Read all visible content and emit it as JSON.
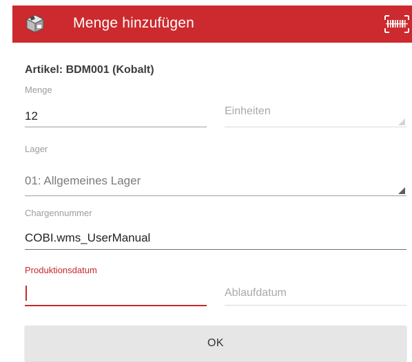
{
  "app_bar": {
    "title": "Menge hinzufügen",
    "background": "#cc2a2e",
    "left_icon": "box-app-icon",
    "right_icon": "barcode-scan-icon"
  },
  "form": {
    "article": "Artikel: BDM001 (Kobalt)",
    "quantity": {
      "label": "Menge",
      "value": "12"
    },
    "unit": {
      "placeholder": "Einheiten"
    },
    "warehouse": {
      "label": "Lager",
      "value": "01: Allgemeines Lager"
    },
    "batch": {
      "label": "Chargennummer",
      "value": "COBI.wms_UserManual"
    },
    "production_date": {
      "label": "Produktionsdatum",
      "value": ""
    },
    "expiry_date": {
      "placeholder": "Ablaufdatum"
    }
  },
  "ok_button": {
    "label": "OK"
  },
  "colors": {
    "accent": "#c62828",
    "appbar": "#cc2a2e",
    "button": "#e6e6e6"
  }
}
